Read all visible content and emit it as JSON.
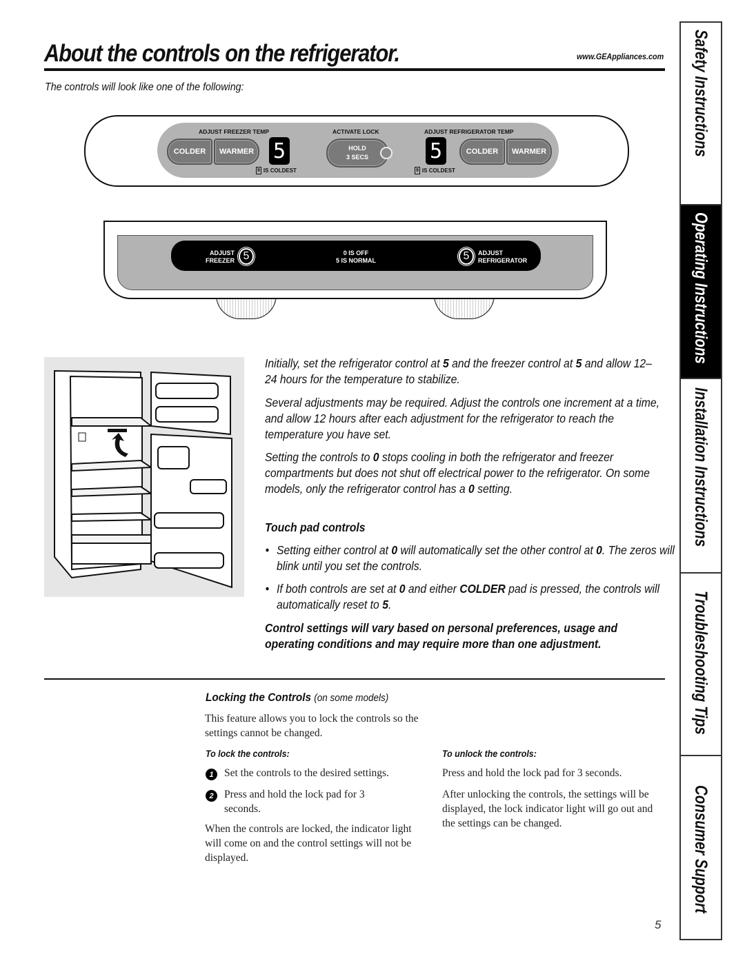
{
  "header": {
    "title": "About the controls on the refrigerator.",
    "url": "www.GEAppliances.com",
    "subtitle": "The controls will look like one of the following:"
  },
  "touch_panel": {
    "freezer_label": "ADJUST FREEZER TEMP",
    "lock_label": "ACTIVATE LOCK",
    "refrigerator_label": "ADJUST REFRIGERATOR TEMP",
    "colder": "COLDER",
    "warmer": "WARMER",
    "lock_line1": "HOLD",
    "lock_line2": "3 SECS",
    "freezer_display": "5",
    "refrigerator_display": "5",
    "coldest_num": "9",
    "coldest_text": "IS COLDEST"
  },
  "dial_panel": {
    "freezer_line1": "ADJUST",
    "freezer_line2": "FREEZER",
    "freezer_value": "5",
    "center_line1": "0 IS OFF",
    "center_line2": "5 IS NORMAL",
    "refrigerator_value": "5",
    "refrigerator_line1": "ADJUST",
    "refrigerator_line2": "REFRIGERATOR"
  },
  "body": {
    "p1_a": "Initially, set the refrigerator control at ",
    "p1_b": "5",
    "p1_c": " and the freezer control at ",
    "p1_d": "5",
    "p1_e": " and allow 12–24 hours for the temperature to stabilize.",
    "p2": "Several adjustments may be required. Adjust the controls one increment at a time, and allow 12 hours after each adjustment for the refrigerator to reach the temperature you have set.",
    "p3_a": "Setting the controls to ",
    "p3_b": "0",
    "p3_c": " stops cooling in both the refrigerator and freezer compartments but does not shut off electrical power to the refrigerator. On some models, only the refrigerator control has a ",
    "p3_d": "0",
    "p3_e": " setting.",
    "touch_heading": "Touch pad controls",
    "bullet1_a": "Setting either control at ",
    "bullet1_b": "0",
    "bullet1_c": " will automatically set the other control at ",
    "bullet1_d": "0",
    "bullet1_e": ". The zeros will blink until you set the controls.",
    "bullet2_a": "If both controls are set at ",
    "bullet2_b": "0",
    "bullet2_c": " and either ",
    "bullet2_d": "COLDER",
    "bullet2_e": " pad is pressed, the controls will automatically reset to ",
    "bullet2_f": "5",
    "bullet2_g": ".",
    "note": "Control settings will vary based on personal preferences, usage and operating conditions and may require more than one adjustment."
  },
  "locking": {
    "title": "Locking the Controls",
    "title_note": "(on some models)",
    "intro": "This feature allows you to lock the controls so the settings cannot be changed.",
    "lock_heading": "To lock the controls:",
    "steps": [
      {
        "num": "1",
        "text": "Set the controls to the desired settings."
      },
      {
        "num": "2",
        "text": "Press and hold the lock pad for 3 seconds."
      }
    ],
    "locked_note": "When the controls are locked, the indicator light will come on and the control settings will not be displayed.",
    "unlock_heading": "To unlock the controls:",
    "unlock_step": "Press and hold the lock pad for 3 seconds.",
    "unlock_note": "After unlocking the controls, the settings will be displayed, the lock indicator light will go out and the settings can be changed."
  },
  "sidebar": {
    "tabs": [
      {
        "label": "Safety Instructions",
        "active": false
      },
      {
        "label": "Operating Instructions",
        "active": true
      },
      {
        "label": "Installation Instructions",
        "active": false
      },
      {
        "label": "Troubleshooting Tips",
        "active": false
      },
      {
        "label": "Consumer Support",
        "active": false
      }
    ]
  },
  "page_number": "5"
}
